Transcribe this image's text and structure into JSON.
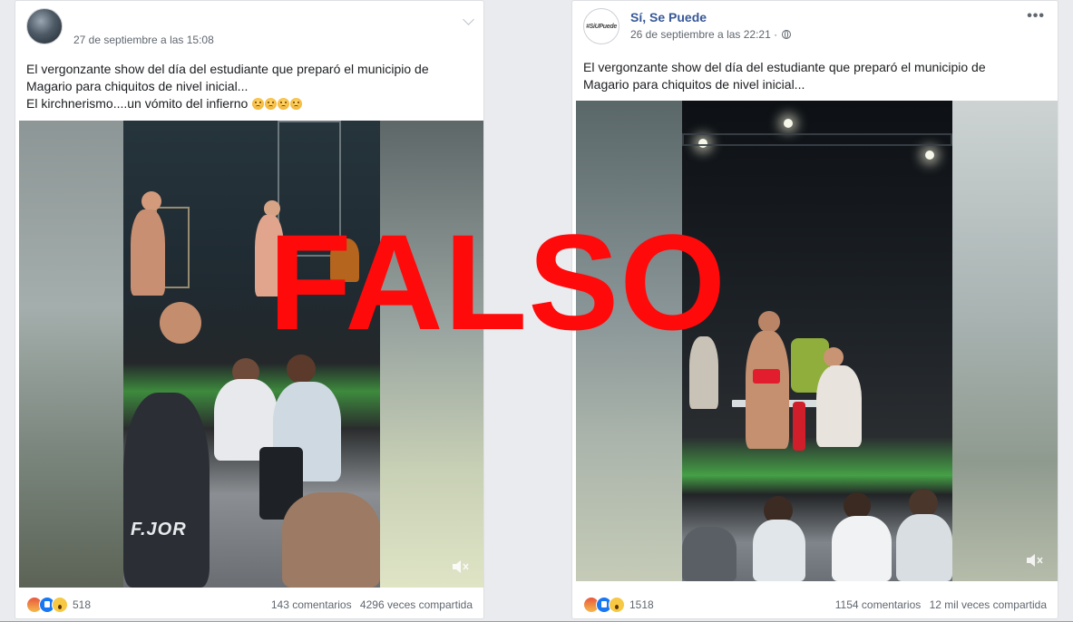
{
  "left_post": {
    "timestamp": "27 de septiembre a las 15:08",
    "caption_line1": "El vergonzante show del día del estudiante que preparó el municipio de",
    "caption_line2": "Magario para chiquitos de nivel inicial...",
    "caption_line3": "El kirchnerismo....un vómito del infierno",
    "shirt_text": "F.JOR",
    "reaction_count": "518",
    "comments": "143 comentarios",
    "shares": "4296 veces compartida"
  },
  "right_post": {
    "page_name": "Sí, Se Puede",
    "timestamp": "26 de septiembre a las 22:21 ·",
    "avatar_text": "#SiUPuede",
    "caption_line1": "El vergonzante show del día del estudiante que preparó el municipio de",
    "caption_line2": "Magario para chiquitos de nivel inicial...",
    "reaction_count": "1518",
    "comments": "1154 comentarios",
    "shares": "12 mil veces compartida"
  },
  "overlay": {
    "verdict": "FALSO",
    "color": "#ff0a0a"
  },
  "icons": [
    "chevron-down-icon",
    "more-options-icon",
    "globe-icon",
    "angry-reaction-icon",
    "like-reaction-icon",
    "wow-reaction-icon",
    "mute-icon",
    "emoji-angry-icon"
  ]
}
